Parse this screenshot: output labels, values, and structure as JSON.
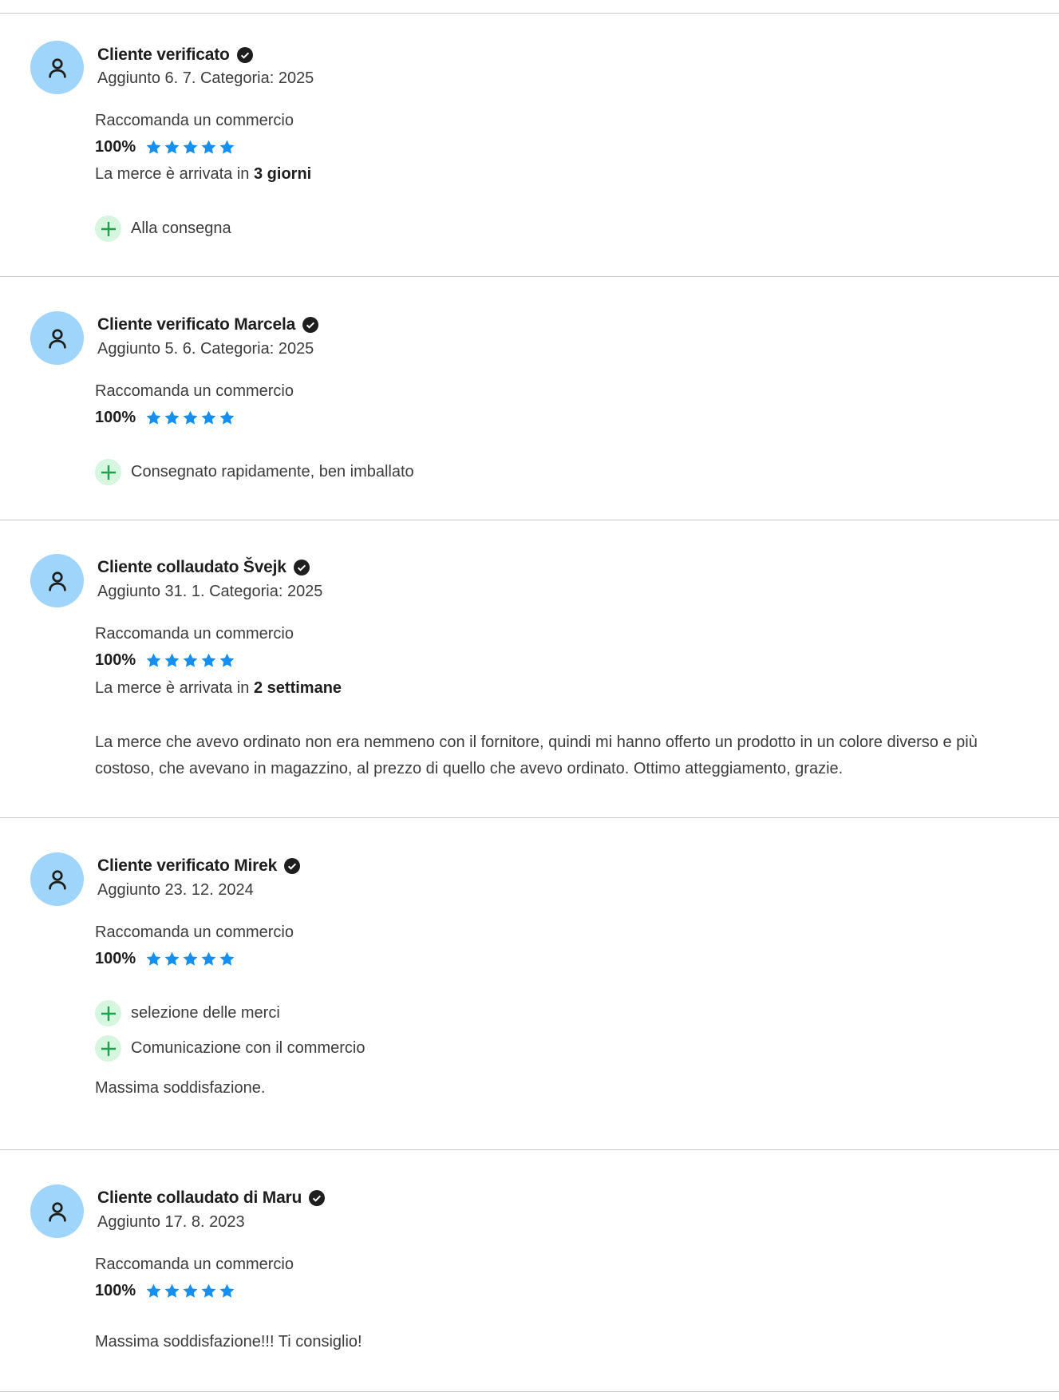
{
  "colors": {
    "avatar_bg": "#9fd4fb",
    "star": "#1590f2",
    "plus_bg": "#d6f6df",
    "plus": "#1aa34a",
    "divider": "#c8c8c8"
  },
  "icons": {
    "avatar": "user-outline-icon",
    "verified": "check-badge-icon",
    "star": "star-icon",
    "pro": "plus-icon"
  },
  "reviews": [
    {
      "author": "Cliente verificato",
      "meta": "Aggiunto 6. 7. Categoria: 2025",
      "recommend_label": "Raccomanda un commercio",
      "score": "100%",
      "rating": 5,
      "delivery_prefix": "La merce è arrivata in",
      "delivery_value": "3 giorni",
      "pros": [
        "Alla consegna"
      ],
      "comment": ""
    },
    {
      "author": "Cliente verificato Marcela",
      "meta": "Aggiunto 5. 6. Categoria: 2025",
      "recommend_label": "Raccomanda un commercio",
      "score": "100%",
      "rating": 5,
      "pros": [
        "Consegnato rapidamente, ben imballato"
      ],
      "comment": ""
    },
    {
      "author": "Cliente collaudato Švejk",
      "meta": "Aggiunto 31. 1. Categoria: 2025",
      "recommend_label": "Raccomanda un commercio",
      "score": "100%",
      "rating": 5,
      "delivery_prefix": "La merce è arrivata in",
      "delivery_value": "2 settimane",
      "pros": [],
      "comment": "La merce che avevo ordinato non era nemmeno con il fornitore, quindi mi hanno offerto un prodotto in un colore diverso e più costoso, che avevano in magazzino, al prezzo di quello che avevo ordinato. Ottimo atteggiamento, grazie."
    },
    {
      "author": "Cliente verificato Mirek",
      "meta": "Aggiunto 23. 12. 2024",
      "recommend_label": "Raccomanda un commercio",
      "score": "100%",
      "rating": 5,
      "pros": [
        "selezione delle merci",
        "Comunicazione con il commercio"
      ],
      "comment": "Massima soddisfazione."
    },
    {
      "author": "Cliente collaudato di Maru",
      "meta": "Aggiunto 17. 8. 2023",
      "recommend_label": "Raccomanda un commercio",
      "score": "100%",
      "rating": 5,
      "pros": [],
      "comment": "Massima soddisfazione!!! Ti consiglio!"
    }
  ]
}
